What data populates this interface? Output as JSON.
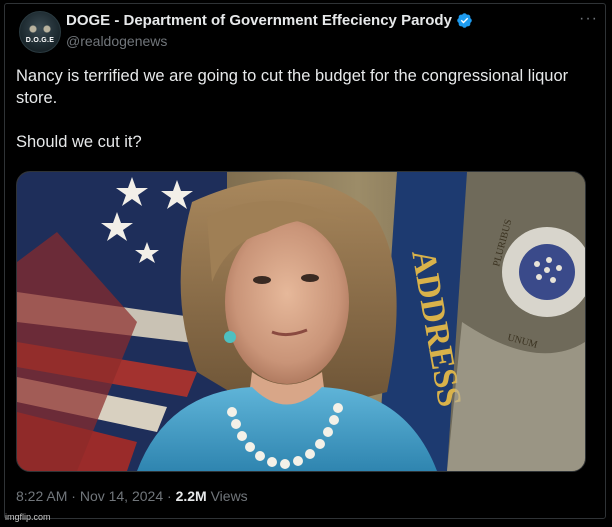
{
  "author": {
    "display_name": "DOGE - Department of Government Effeciency Parody",
    "handle": "@realdogenews",
    "avatar_text": "D.O.G.E",
    "verified": true
  },
  "tweet": {
    "paragraphs": [
      "Nancy is terrified we are going to cut the budget for the congressional liquor store.",
      "Should we cut it?"
    ]
  },
  "media": {
    "flag_text_left": "ADDRESS",
    "seal_text": [
      "PLURIBUS",
      "UNUM"
    ]
  },
  "meta": {
    "time": "8:22 AM",
    "separator": "·",
    "date": "Nov 14, 2024",
    "views_count": "2.2M",
    "views_label": "Views"
  },
  "more_icon": "more-horizontal-icon",
  "watermark": "imgflip.com",
  "colors": {
    "background": "#000000",
    "text": "#e7e9ea",
    "muted": "#71767b",
    "verified": "#1d9bf0",
    "border": "#2f3336"
  }
}
